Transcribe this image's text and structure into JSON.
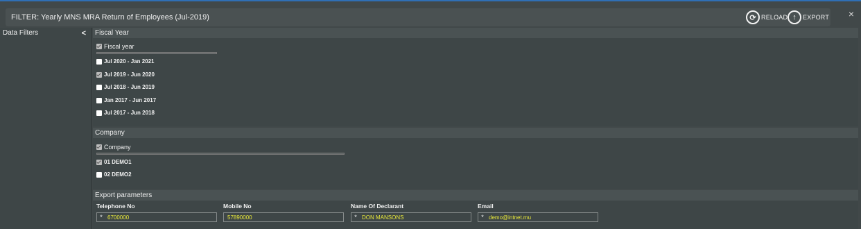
{
  "window": {
    "title": "FILTER: Yearly MNS MRA Return of Employees (Jul-2019)",
    "reload_label": "RELOAD",
    "export_label": "EXPORT",
    "close_glyph": "×"
  },
  "sidebar": {
    "header": "Data Filters",
    "collapse_glyph": "<"
  },
  "fiscal_year": {
    "section_title": "Fiscal Year",
    "header_item": "Fiscal year",
    "items": [
      {
        "label": "Jul 2020 - Jan 2021",
        "checked": false
      },
      {
        "label": "Jul 2019 - Jun 2020",
        "checked": true
      },
      {
        "label": "Jul 2018 - Jun 2019",
        "checked": false
      },
      {
        "label": "Jan 2017 - Jun 2017",
        "checked": false
      },
      {
        "label": "Jul 2017 - Jun 2018",
        "checked": false
      }
    ]
  },
  "company": {
    "section_title": "Company",
    "header_item": "Company",
    "items": [
      {
        "label": "01 DEMO1",
        "checked": true
      },
      {
        "label": "02 DEMO2",
        "checked": false
      }
    ]
  },
  "export": {
    "section_title": "Export parameters",
    "fields": [
      {
        "label": "Telephone No",
        "value": "6700000",
        "required": "*"
      },
      {
        "label": "Mobile No",
        "value": "57890000",
        "required": ""
      },
      {
        "label": "Name Of Declarant",
        "value": "DON MANSONS",
        "required": "*"
      },
      {
        "label": "Email",
        "value": "demo@intnet.mu",
        "required": "*"
      }
    ]
  },
  "colors": {
    "accent_border": "#2f6fb5",
    "field_value": "#e8e83a"
  }
}
